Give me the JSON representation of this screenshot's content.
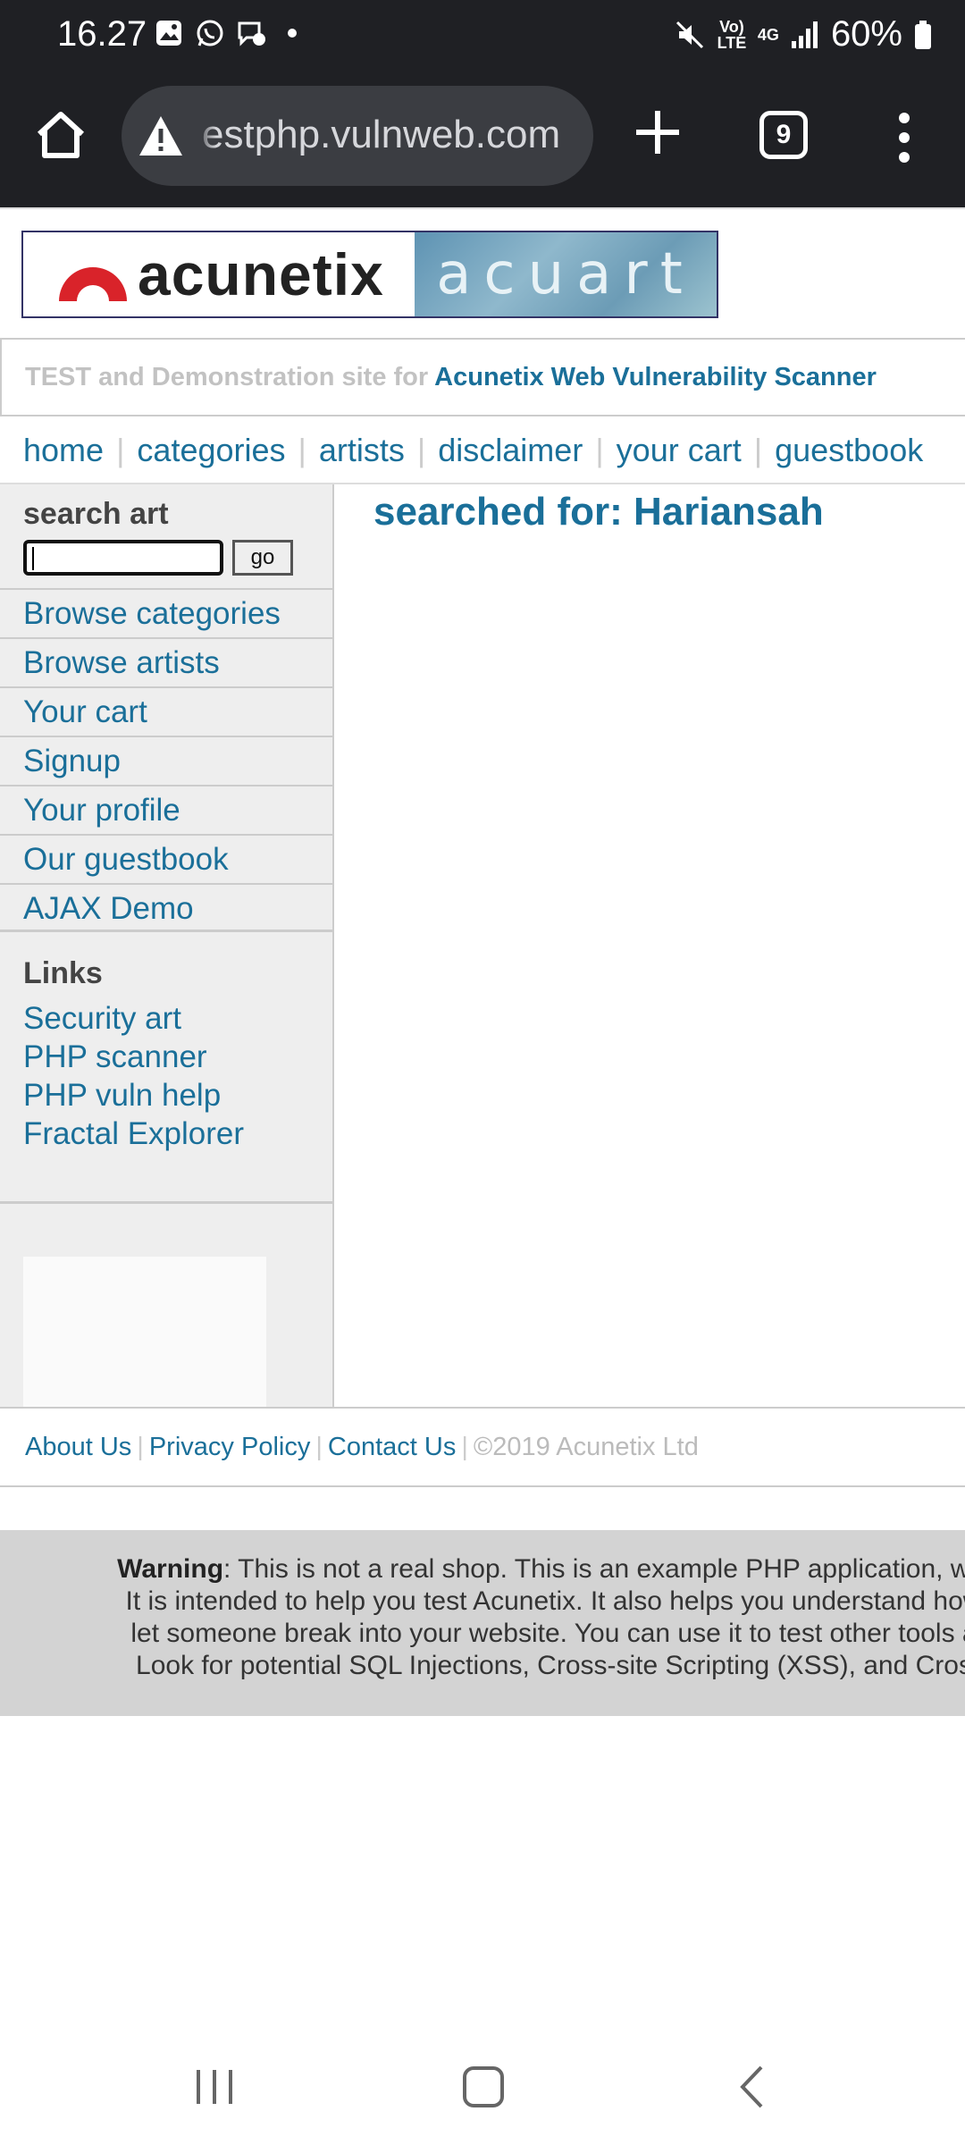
{
  "status_bar": {
    "time": "16.27",
    "volte": "Vo) LTE",
    "network": "4G",
    "battery": "60%",
    "icons": [
      "gallery-icon",
      "whatsapp-icon",
      "messenger-icon",
      "dot-icon",
      "mute-icon",
      "signal-icon",
      "battery-icon"
    ]
  },
  "browser": {
    "url": "estphp.vulnweb.com",
    "tab_count": "9",
    "icons": [
      "home-icon",
      "warning-icon",
      "plus-icon",
      "tabs-icon",
      "menu-icon"
    ]
  },
  "site": {
    "logo_text": "acunetix",
    "logo_right": "acuart",
    "tagline_prefix": "TEST and Demonstration site for",
    "tagline_link": "Acunetix Web Vulnerability Scanner",
    "topnav": [
      "home",
      "categories",
      "artists",
      "disclaimer",
      "your cart",
      "guestbook"
    ],
    "search_label": "search art",
    "search_value": "",
    "go_label": "go",
    "side_menu": [
      "Browse categories",
      "Browse artists",
      "Your cart",
      "Signup",
      "Your profile",
      "Our guestbook",
      "AJAX Demo"
    ],
    "links_title": "Links",
    "links": [
      "Security art",
      "PHP scanner",
      "PHP vuln help",
      "Fractal Explorer"
    ],
    "content_title": "searched for: Hariansah",
    "footer_links": [
      "About Us",
      "Privacy Policy",
      "Contact Us"
    ],
    "copyright": "©2019 Acunetix Ltd",
    "warning_bold": "Warning",
    "warning_lines": [
      ": This is not a real shop. This is an example PHP application, whi",
      "It is intended to help you test Acunetix. It also helps you understand how",
      "let someone break into your website. You can use it to test other tools a",
      "Look for potential SQL Injections, Cross-site Scripting (XSS), and Cros"
    ]
  },
  "colors": {
    "link": "#1a6f99",
    "chrome_bg": "#1f2024",
    "sidebar_bg": "#eeeeee",
    "warning_bg": "#d3d3d3"
  }
}
